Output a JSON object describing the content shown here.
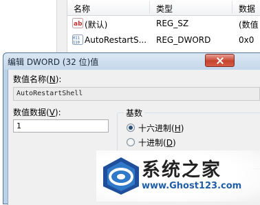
{
  "list": {
    "columns": [
      "名称",
      "类型",
      "数据"
    ],
    "rows": [
      {
        "icon": "string-value-icon",
        "name": "(默认)",
        "type": "REG_SZ",
        "data": "(数值"
      },
      {
        "icon": "dword-value-icon",
        "name": "AutoRestartS...",
        "type": "REG_DWORD",
        "data": "0x0"
      }
    ]
  },
  "dialog": {
    "title": "编辑 DWORD (32 位)值",
    "value_name_label": "数值名称",
    "value_name_key": "N",
    "value_name": "AutoRestartShell",
    "value_data_label": "数值数据",
    "value_data_key": "V",
    "value_data": "1",
    "base_label": "基数",
    "hex_label": "十六进制",
    "hex_key": "H",
    "hex_checked": true,
    "dec_label": "十进制",
    "dec_key": "D",
    "dec_checked": false
  },
  "watermark": {
    "text": "系统之家",
    "url": "www.Ghost123.com"
  },
  "colors": {
    "dialog_frame": "#bcd0e6",
    "close_button": "#c7442f",
    "watermark_url": "#1f5ea8"
  }
}
